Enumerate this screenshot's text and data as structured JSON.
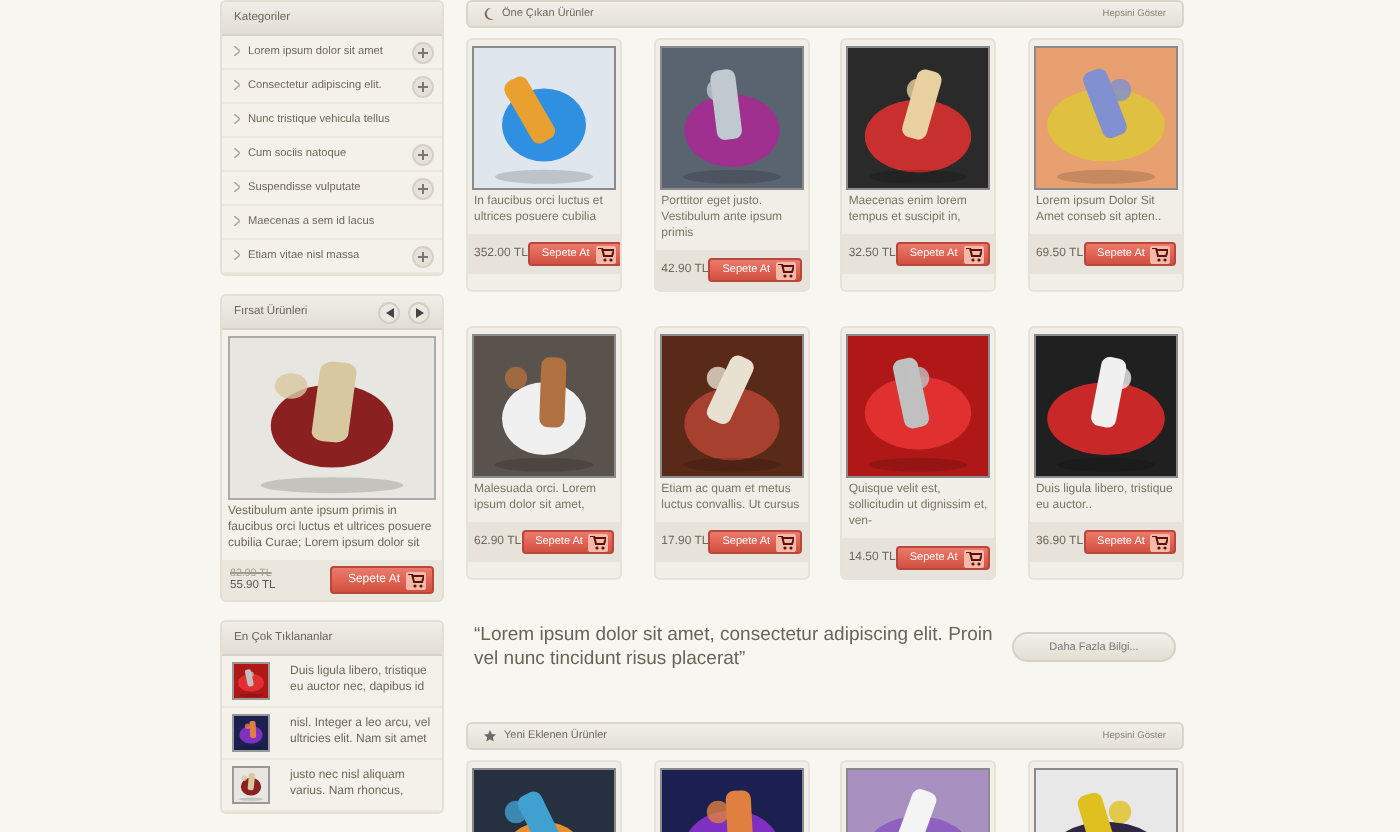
{
  "categories": {
    "title": "Kategoriler",
    "items": [
      {
        "label": "Lorem ipsum dolor sit amet",
        "expandable": true
      },
      {
        "label": "Consectetur adipiscing elit.",
        "expandable": true
      },
      {
        "label": "Nunc tristique vehicula tellus",
        "expandable": false
      },
      {
        "label": "Cum sociis natoque",
        "expandable": true
      },
      {
        "label": "Suspendisse vulputate",
        "expandable": true
      },
      {
        "label": "Maecenas a sem id lacus",
        "expandable": false
      },
      {
        "label": "Etiam vitae nisl massa",
        "expandable": true
      }
    ]
  },
  "deals": {
    "title": "Fırsat Ürünleri",
    "description": "Vestibulum ante ipsum primis in faucibus orci luctus et ultrices posuere cubilia Curae; Lorem ipsum dolor sit",
    "old_price": "82.90 TL",
    "price": "55.90 TL",
    "button": "Sepete At"
  },
  "most_clicked": {
    "title": "En Çok Tıklananlar",
    "items": [
      {
        "text": "Duis ligula libero, tristique eu auctor nec, dapibus id"
      },
      {
        "text": "nisl. Integer a leo arcu, vel ultricies elit. Nam sit amet"
      },
      {
        "text": "justo nec nisl aliquam varius. Nam rhoncus,"
      }
    ]
  },
  "featured": {
    "title": "Öne Çıkan Ürünler",
    "link": "Hepsini Göster",
    "products": [
      {
        "description": "In faucibus orci luctus et ultrices posuere cubilia",
        "price": "352.00 TL",
        "button": "Sepete At"
      },
      {
        "description": "Porttitor eget justo. Vestibulum ante ipsum primis",
        "price": "42.90 TL",
        "button": "Sepete At"
      },
      {
        "description": "Maecenas enim lorem tempus et suscipit in,",
        "price": "32.50 TL",
        "button": "Sepete At"
      },
      {
        "description": "Lorem ipsum Dolor Sit Amet conseb sit apten..",
        "price": "69.50 TL",
        "button": "Sepete At"
      },
      {
        "description": "Malesuada orci. Lorem ipsum dolor sit amet,",
        "price": "62.90 TL",
        "button": "Sepete At"
      },
      {
        "description": "Etiam ac quam et metus luctus convallis. Ut cursus",
        "price": "17.90 TL",
        "button": "Sepete At"
      },
      {
        "description": "Quisque velit est, sollicitudin ut dignissim et, ven-",
        "price": "14.50 TL",
        "button": "Sepete At"
      },
      {
        "description": "Duis ligula libero, tristique eu auctor..",
        "price": "36.90 TL",
        "button": "Sepete At"
      }
    ]
  },
  "quote": {
    "text": "“Lorem ipsum dolor sit amet, consectetur adipiscing elit. Proin vel nunc tincidunt risus placerat”",
    "button": "Daha Fazla Bilgi..."
  },
  "new_products": {
    "title": "Yeni Eklenen Ürünler",
    "link": "Hepsini Göster"
  }
}
